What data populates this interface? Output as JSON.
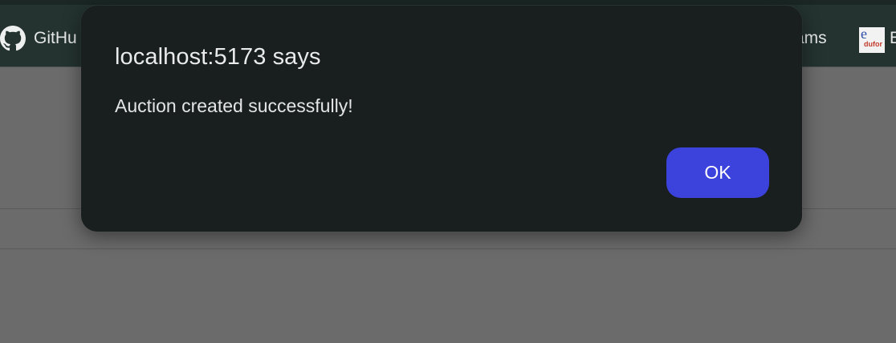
{
  "bookmarks": {
    "github_label": "GitHu",
    "teams_label": "ams",
    "edge_label": "E",
    "edu_logo_letter": "e",
    "edu_logo_text": "dufor"
  },
  "dialog": {
    "title": "localhost:5173 says",
    "message": "Auction created successfully!",
    "ok_label": "OK"
  },
  "colors": {
    "dialog_background": "#191e1f",
    "ok_button": "#3b43dc",
    "overlay_page": "#6b6b6b",
    "bookmarks_bar": "#243330"
  }
}
